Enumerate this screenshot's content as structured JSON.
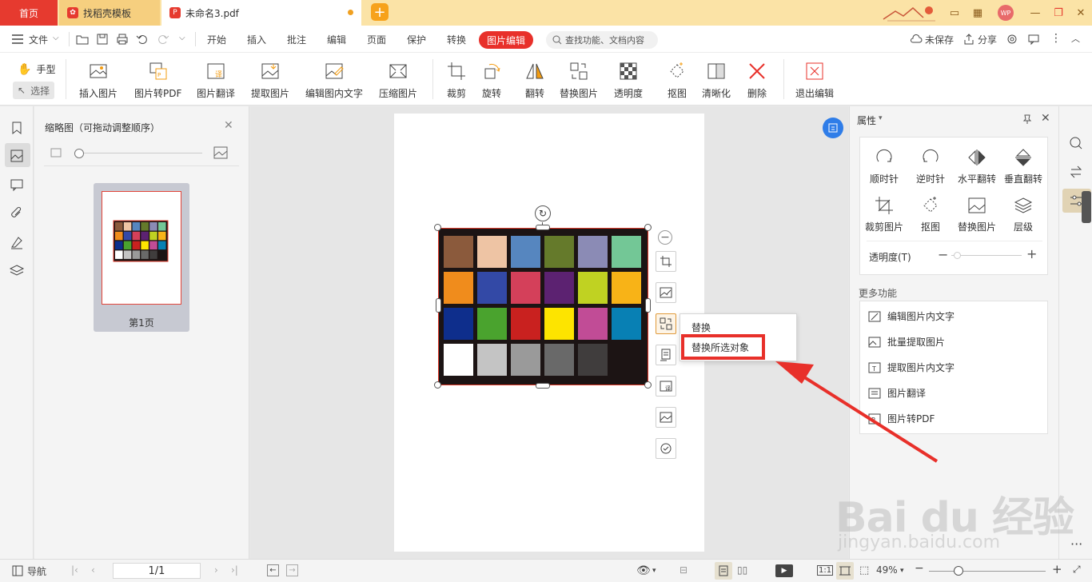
{
  "titlebar": {
    "tabs": [
      {
        "label": "首页"
      },
      {
        "label": "找稻壳模板"
      },
      {
        "label": "未命名3.pdf"
      }
    ],
    "user_badge": "WP"
  },
  "menubar": {
    "file": "文件",
    "items": [
      "开始",
      "插入",
      "批注",
      "编辑",
      "页面",
      "保护",
      "转换"
    ],
    "active": "图片编辑",
    "search_placeholder": "查找功能、文档内容",
    "unsaved": "未保存",
    "share": "分享"
  },
  "ribbon": {
    "hand": "手型",
    "select": "选择",
    "buttons": [
      "插入图片",
      "图片转PDF",
      "图片翻译",
      "提取图片",
      "编辑图内文字",
      "压缩图片",
      "裁剪",
      "旋转",
      "翻转",
      "替换图片",
      "透明度",
      "抠图",
      "清晰化",
      "删除",
      "退出编辑"
    ]
  },
  "thumbnails": {
    "title": "缩略图（可拖动调整顺序）",
    "page_label": "第1页"
  },
  "context_menu": {
    "items": [
      "替换",
      "替换所选对象"
    ]
  },
  "properties": {
    "title": "属性",
    "grid": [
      "顺时针",
      "逆时针",
      "水平翻转",
      "垂直翻转",
      "裁剪图片",
      "抠图",
      "替换图片",
      "层级"
    ],
    "opacity_label": "透明度(T)",
    "more_title": "更多功能",
    "more_items": [
      "编辑图片内文字",
      "批量提取图片",
      "提取图片内文字",
      "图片翻译",
      "图片转PDF"
    ]
  },
  "statusbar": {
    "nav": "导航",
    "page": "1/1",
    "zoom": "49%",
    "ratio": "1:1"
  },
  "color_checker": [
    [
      "#8b5a3c",
      "#eec4a4",
      "#5686bf",
      "#657a2b",
      "#8b8bb5",
      "#73c796"
    ],
    [
      "#f08c1c",
      "#3349a6",
      "#d4405a",
      "#5c2271",
      "#c0d222",
      "#f8b317"
    ],
    [
      "#0e2e8c",
      "#4aa32e",
      "#c9211f",
      "#fde400",
      "#c14c96",
      "#0880b4"
    ],
    [
      "#ffffff",
      "#c4c4c4",
      "#9a9a9a",
      "#696969",
      "#403d3d",
      "#1c1414"
    ]
  ],
  "watermark": {
    "logo": "Bai du 经验",
    "url": "jingyan.baidu.com"
  },
  "accent": "#e8302a"
}
